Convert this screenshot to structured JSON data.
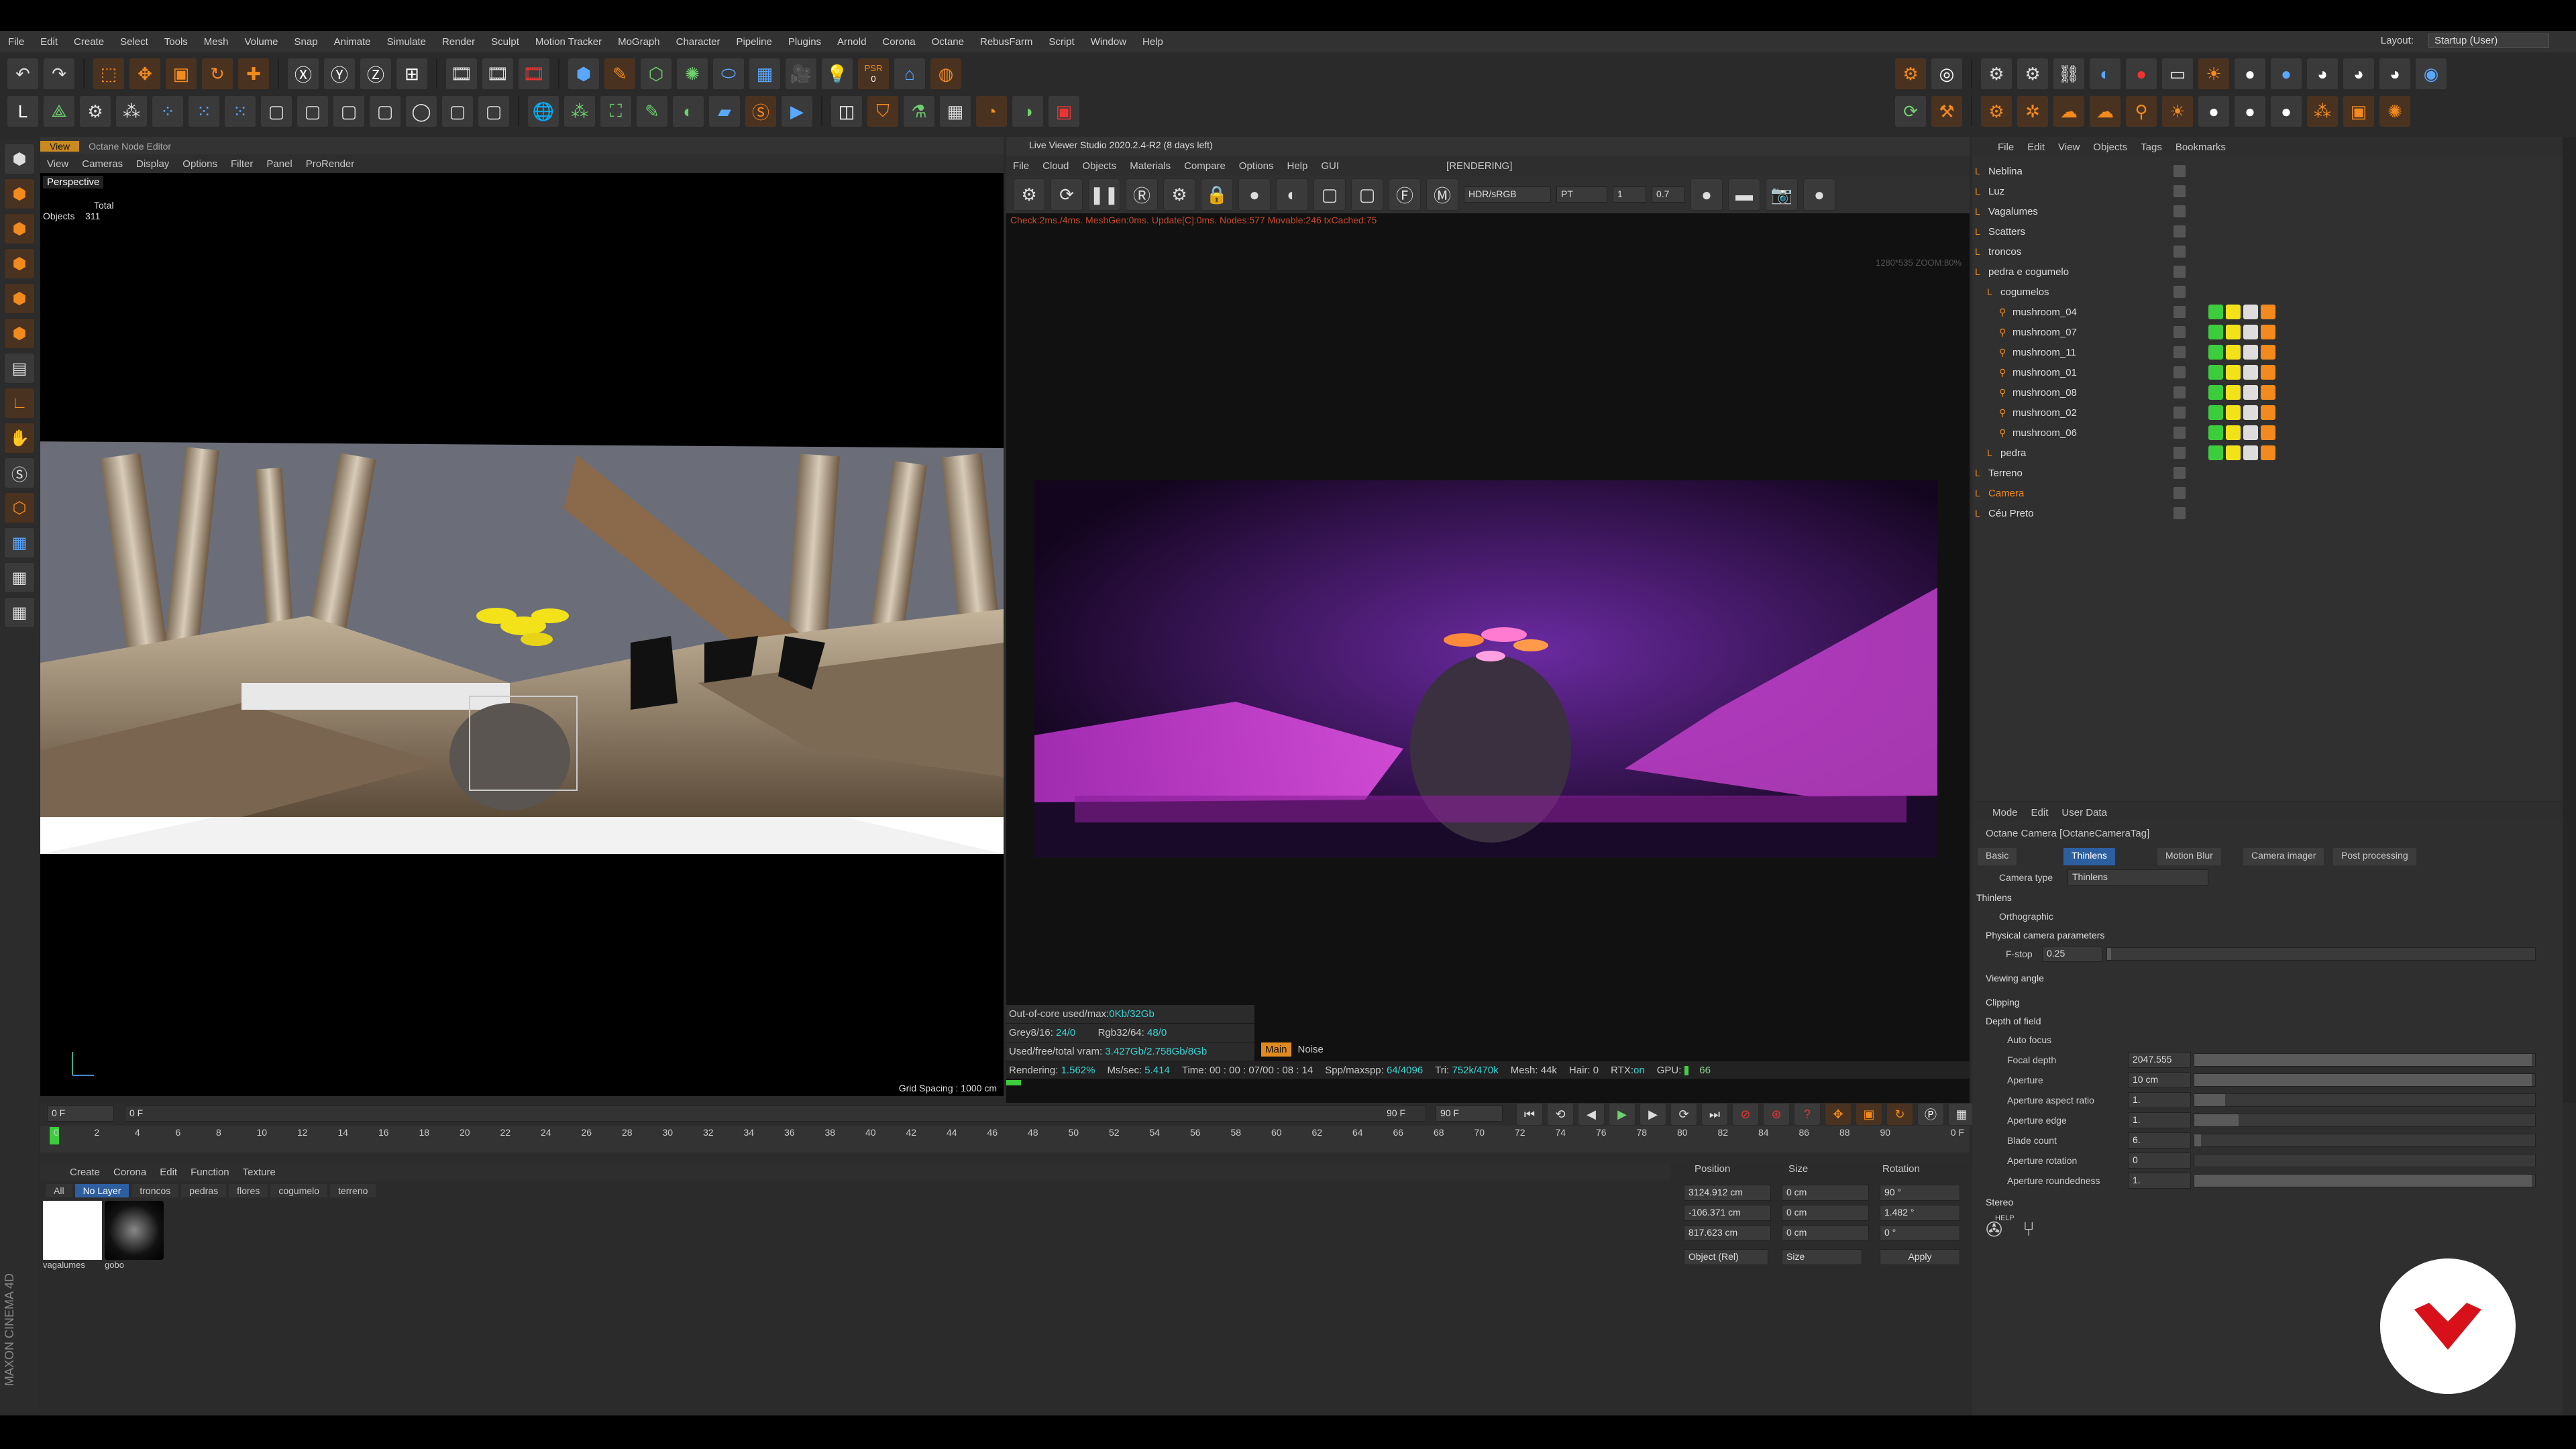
{
  "menubar": {
    "items": [
      "File",
      "Edit",
      "Create",
      "Select",
      "Tools",
      "Mesh",
      "Volume",
      "Snap",
      "Animate",
      "Simulate",
      "Render",
      "Sculpt",
      "Motion Tracker",
      "MoGraph",
      "Character",
      "Pipeline",
      "Plugins",
      "Arnold",
      "Corona",
      "Octane",
      "RebusFarm",
      "Script",
      "Window",
      "Help"
    ],
    "layout_label": "Layout:",
    "layout_value": "Startup (User)"
  },
  "toolbar": {
    "psr_label": "PSR",
    "psr_value": "0"
  },
  "viewport": {
    "tabs": [
      "View",
      "Octane Node Editor"
    ],
    "menu": [
      "View",
      "Cameras",
      "Display",
      "Options",
      "Filter",
      "Panel",
      "ProRender"
    ],
    "camera": "Perspective",
    "stats_header": "Total",
    "stats_label": "Objects",
    "stats_value": "311",
    "grid_spacing": "Grid Spacing : 1000 cm"
  },
  "live_viewer": {
    "title": "Live Viewer Studio 2020.2.4-R2 (8 days left)",
    "menu": [
      "File",
      "Cloud",
      "Objects",
      "Materials",
      "Compare",
      "Options",
      "Help",
      "GUI"
    ],
    "status": "[RENDERING]",
    "colorspace": "HDR/sRGB",
    "kernel": "PT",
    "val1": "1",
    "val2": "0.7",
    "check_line": "Check:2ms./4ms. MeshGen:0ms. Update[C]:0ms. Nodes:577 Movable:246 txCached:75",
    "resolution": "1280*535 ZOOM:80%",
    "ooc_label": "Out-of-core used/max:",
    "ooc_value": "0Kb/32Gb",
    "grey_label": "Grey8/16:",
    "grey_value": "24/0",
    "rgb_label": "Rgb32/64:",
    "rgb_value": "48/0",
    "vram_label": "Used/free/total vram:",
    "vram_value": "3.427Gb/2.758Gb/8Gb",
    "main_btn": "Main",
    "noise_btn": "Noise",
    "render_status": {
      "rendering": "Rendering:",
      "rendering_pct": "1.562%",
      "mssec": "Ms/sec:",
      "mssec_val": "5.414",
      "time": "Time: 00 : 00 : 07/00 : 08 : 14",
      "spp": "Spp/maxspp:",
      "spp_val": "64/4096",
      "tri": "Tri:",
      "tri_val": "752k/470k",
      "mesh": "Mesh: 44k",
      "hair": "Hair: 0",
      "rtx": "RTX:",
      "rtx_val": "on",
      "gpu": "GPU:",
      "gpu_val": "66"
    },
    "render_progress": 0.0156
  },
  "object_manager": {
    "menu": [
      "File",
      "Edit",
      "View",
      "Objects",
      "Tags",
      "Bookmarks"
    ],
    "objects": [
      {
        "name": "Neblina",
        "indent": 0,
        "color": "#ddd"
      },
      {
        "name": "Luz",
        "indent": 0,
        "color": "#ddd"
      },
      {
        "name": "Vagalumes",
        "indent": 0,
        "color": "#ddd"
      },
      {
        "name": "Scatters",
        "indent": 0,
        "color": "#ddd"
      },
      {
        "name": "troncos",
        "indent": 0,
        "color": "#ddd"
      },
      {
        "name": "pedra e cogumelo",
        "indent": 0,
        "color": "#ddd"
      },
      {
        "name": "cogumelos",
        "indent": 1,
        "color": "#ddd"
      },
      {
        "name": "mushroom_04",
        "indent": 2,
        "color": "#ddd"
      },
      {
        "name": "mushroom_07",
        "indent": 2,
        "color": "#ddd"
      },
      {
        "name": "mushroom_11",
        "indent": 2,
        "color": "#ddd"
      },
      {
        "name": "mushroom_01",
        "indent": 2,
        "color": "#ddd"
      },
      {
        "name": "mushroom_08",
        "indent": 2,
        "color": "#ddd"
      },
      {
        "name": "mushroom_02",
        "indent": 2,
        "color": "#ddd"
      },
      {
        "name": "mushroom_06",
        "indent": 2,
        "color": "#ddd"
      },
      {
        "name": "pedra",
        "indent": 1,
        "color": "#ddd"
      },
      {
        "name": "Terreno",
        "indent": 0,
        "color": "#ddd"
      },
      {
        "name": "Camera",
        "indent": 0,
        "color": "#f28a1e"
      },
      {
        "name": "Céu Preto",
        "indent": 0,
        "color": "#ddd"
      }
    ]
  },
  "timeline": {
    "start_frame": "0 F",
    "range_start": "0 F",
    "range_end": "90 F",
    "end_frame": "90 F",
    "current": "0 F",
    "ticks": [
      "0",
      "2",
      "4",
      "6",
      "8",
      "10",
      "12",
      "14",
      "16",
      "18",
      "20",
      "22",
      "24",
      "26",
      "28",
      "30",
      "32",
      "34",
      "36",
      "38",
      "40",
      "42",
      "44",
      "46",
      "48",
      "50",
      "52",
      "54",
      "56",
      "58",
      "60",
      "62",
      "64",
      "66",
      "68",
      "70",
      "72",
      "74",
      "76",
      "78",
      "80",
      "82",
      "84",
      "86",
      "88",
      "90"
    ]
  },
  "material_manager": {
    "menu": [
      "Create",
      "Corona",
      "Edit",
      "Function",
      "Texture"
    ],
    "filters": [
      "All",
      "No Layer",
      "troncos",
      "pedras",
      "flores",
      "cogumelo",
      "terreno"
    ],
    "materials": [
      "vagalumes",
      "gobo"
    ]
  },
  "coordinates": {
    "headers": [
      "Position",
      "Size",
      "Rotation"
    ],
    "x_pos": "3124.912 cm",
    "y_pos": "-106.371 cm",
    "z_pos": "817.623 cm",
    "x_size": "0 cm",
    "y_size": "0 cm",
    "z_size": "0 cm",
    "h_rot": "90 °",
    "p_rot": "1.482 °",
    "b_rot": "0 °",
    "mode": "Object (Rel)",
    "size_mode": "Size",
    "apply": "Apply"
  },
  "attributes": {
    "menu": [
      "Mode",
      "Edit",
      "User Data"
    ],
    "object_title": "Octane Camera [OctaneCameraTag]",
    "tabs": [
      "Basic",
      "Thinlens",
      "Motion Blur",
      "Camera imager",
      "Post processing"
    ],
    "camera_type_label": "Camera type",
    "camera_type_value": "Thinlens",
    "section_thinlens": "Thinlens",
    "orthographic": "Orthographic",
    "physical": "Physical camera parameters",
    "fstop_label": "F-stop",
    "fstop_value": "0.25",
    "viewing_angle": "Viewing angle",
    "clipping": "Clipping",
    "dof": "Depth of field",
    "autofocus": "Auto focus",
    "focal_depth_label": "Focal depth",
    "focal_depth_value": "2047.555",
    "aperture_label": "Aperture",
    "aperture_value": "10 cm",
    "aspect_label": "Aperture aspect ratio",
    "aspect_value": "1.",
    "edge_label": "Aperture edge",
    "edge_value": "1.",
    "blade_label": "Blade count",
    "blade_value": "6.",
    "rotation_label": "Aperture rotation",
    "rotation_value": "0",
    "roundedness_label": "Aperture roundedness",
    "roundedness_value": "1.",
    "stereo": "Stereo",
    "help": "HELP"
  },
  "branding": {
    "maxon": "MAXON CINEMA 4D"
  }
}
